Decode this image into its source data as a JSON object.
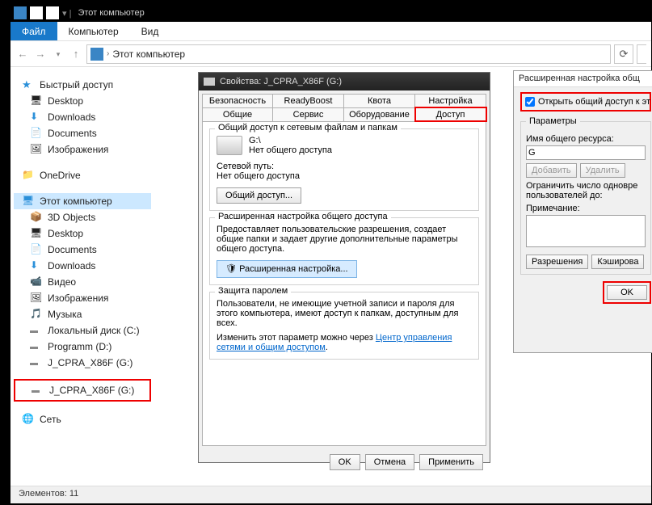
{
  "titlebar": {
    "title": "Этот компьютер"
  },
  "menu": {
    "file": "Файл",
    "computer": "Компьютер",
    "view": "Вид"
  },
  "address": {
    "crumb": "Этот компьютер"
  },
  "sidebar": {
    "quick": "Быстрый доступ",
    "desktop": "Desktop",
    "downloads": "Downloads",
    "documents": "Documents",
    "pictures": "Изображения",
    "onedrive": "OneDrive",
    "thispc": "Этот компьютер",
    "obj3d": "3D Objects",
    "desktop2": "Desktop",
    "documents2": "Documents",
    "downloads2": "Downloads",
    "video": "Видео",
    "pictures2": "Изображения",
    "music": "Музыка",
    "driveC": "Локальный диск (C:)",
    "driveD": "Programm (D:)",
    "driveG": "J_CPRA_X86F (G:)",
    "driveG2": "J_CPRA_X86F (G:)",
    "network": "Сеть"
  },
  "props": {
    "title": "Свойства: J_CPRA_X86F (G:)",
    "tabs": {
      "security": "Безопасность",
      "readyboost": "ReadyBoost",
      "quota": "Квота",
      "setup": "Настройка",
      "general": "Общие",
      "service": "Сервис",
      "hardware": "Оборудование",
      "sharing": "Доступ"
    },
    "group1": {
      "label": "Общий доступ к сетевым файлам и папкам",
      "drive": "G:\\",
      "noshare": "Нет общего доступа",
      "netpath_label": "Сетевой путь:",
      "netpath_value": "Нет общего доступа",
      "sharebtn": "Общий доступ..."
    },
    "group2": {
      "label": "Расширенная настройка общего доступа",
      "desc": "Предоставляет пользовательские разрешения, создает общие папки и задает другие дополнительные параметры общего доступа.",
      "btn": "Расширенная настройка..."
    },
    "group3": {
      "label": "Защита паролем",
      "desc": "Пользователи, не имеющие учетной записи и пароля для этого компьютера, имеют доступ к папкам, доступным для всех.",
      "change": "Изменить этот параметр можно через ",
      "link": "Центр управления сетями и общим доступом"
    },
    "buttons": {
      "ok": "OK",
      "cancel": "Отмена",
      "apply": "Применить"
    }
  },
  "adv": {
    "title": "Расширенная настройка общ",
    "checkbox": "Открыть общий доступ к эт",
    "params": "Параметры",
    "sharename": "Имя общего ресурса:",
    "sharevalue": "G",
    "add": "Добавить",
    "remove": "Удалить",
    "limit": "Ограничить число одновре пользователей до:",
    "note": "Примечание:",
    "perm": "Разрешения",
    "cache": "Кэширова",
    "ok": "OK"
  },
  "status": {
    "elements": "Элементов: 11"
  }
}
